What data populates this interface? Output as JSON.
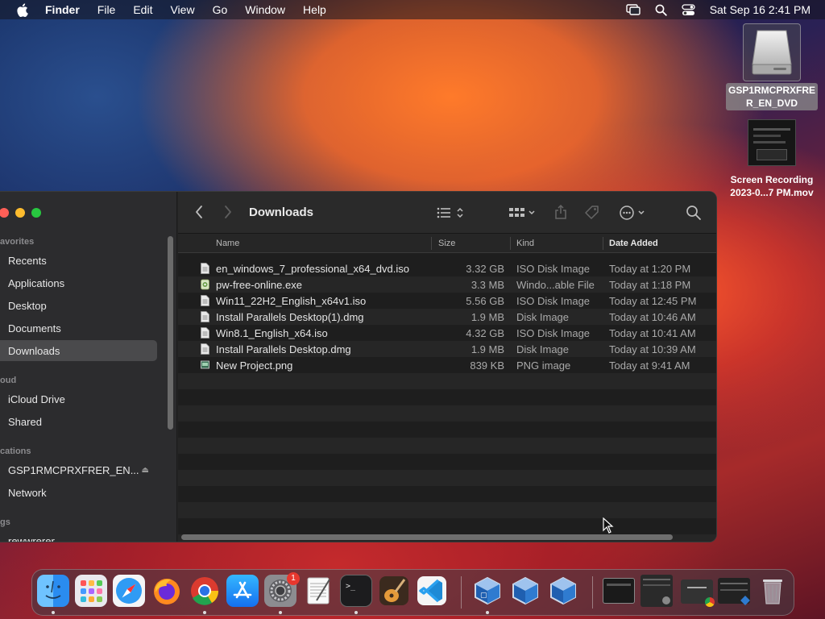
{
  "menubar": {
    "app_name": "Finder",
    "menus": [
      "File",
      "Edit",
      "View",
      "Go",
      "Window",
      "Help"
    ],
    "clock": "Sat Sep 16  2:41 PM"
  },
  "desktop": {
    "dvd_label": "GSP1RMCPRXFRE\nR_EN_DVD",
    "dvd_line1": "GSP1RMCPRXFRE",
    "dvd_line2": "R_EN_DVD",
    "recording_line1": "Screen Recording",
    "recording_line2": "2023-0...7 PM.mov"
  },
  "sidebar": {
    "favorites_header": "avorites",
    "favorites": [
      "Recents",
      "Applications",
      "Desktop",
      "Documents",
      "Downloads"
    ],
    "active_item": "Downloads",
    "icloud_header": "oud",
    "icloud": [
      "iCloud Drive",
      "Shared"
    ],
    "locations_header": "cations",
    "locations": [
      "GSP1RMCPRXFRER_EN...",
      "Network"
    ],
    "tags_header": "gs",
    "tags": [
      "rewwrerer"
    ]
  },
  "toolbar": {
    "title": "Downloads"
  },
  "columns": {
    "name": "Name",
    "size": "Size",
    "kind": "Kind",
    "date": "Date Added"
  },
  "files": [
    {
      "name": "en_windows_7_professional_x64_dvd.iso",
      "size": "3.32 GB",
      "kind": "ISO Disk Image",
      "date": "Today at 1:20 PM",
      "icon": "document-icon"
    },
    {
      "name": "pw-free-online.exe",
      "size": "3.3 MB",
      "kind": "Windo...able File",
      "date": "Today at 1:18 PM",
      "icon": "exe-icon"
    },
    {
      "name": "Win11_22H2_English_x64v1.iso",
      "size": "5.56 GB",
      "kind": "ISO Disk Image",
      "date": "Today at 12:45 PM",
      "icon": "document-icon"
    },
    {
      "name": "Install Parallels Desktop(1).dmg",
      "size": "1.9 MB",
      "kind": "Disk Image",
      "date": "Today at 10:46 AM",
      "icon": "document-icon"
    },
    {
      "name": "Win8.1_English_x64.iso",
      "size": "4.32 GB",
      "kind": "ISO Disk Image",
      "date": "Today at 10:41 AM",
      "icon": "document-icon"
    },
    {
      "name": "Install Parallels Desktop.dmg",
      "size": "1.9 MB",
      "kind": "Disk Image",
      "date": "Today at 10:39 AM",
      "icon": "document-icon"
    },
    {
      "name": "New Project.png",
      "size": "839 KB",
      "kind": "PNG image",
      "date": "Today at 9:41 AM",
      "icon": "image-icon"
    }
  ],
  "dock": {
    "settings_badge": "1"
  },
  "colors": {
    "traffic_close": "#ff5f57",
    "traffic_min": "#febc2e",
    "traffic_max": "#28c840",
    "badge": "#e8372e"
  }
}
